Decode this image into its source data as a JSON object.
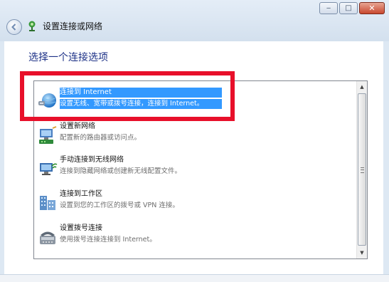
{
  "window": {
    "minimize_label": "‒",
    "maximize_label": "□",
    "close_label": "✕"
  },
  "nav": {
    "breadcrumb": "设置连接或网络"
  },
  "main": {
    "heading": "选择一个连接选项",
    "options": [
      {
        "title": "连接到 Internet",
        "description": "设置无线、宽带或拨号连接，连接到 Internet。",
        "icon": "globe-internet-icon",
        "selected": true
      },
      {
        "title": "设置新网络",
        "description": "配置新的路由器或访问点。",
        "icon": "router-icon",
        "selected": false
      },
      {
        "title": "手动连接到无线网络",
        "description": "连接到隐藏网络或创建新无线配置文件。",
        "icon": "wireless-computer-icon",
        "selected": false
      },
      {
        "title": "连接到工作区",
        "description": "设置到您的工作区的拨号或 VPN 连接。",
        "icon": "workplace-icon",
        "selected": false
      },
      {
        "title": "设置拨号连接",
        "description": "使用拨号连接连接到 Internet。",
        "icon": "phone-modem-icon",
        "selected": false
      }
    ]
  },
  "annotation": {
    "highlight_color": "#e8102a"
  },
  "colors": {
    "selection": "#3399ff",
    "heading": "#1e3287"
  }
}
